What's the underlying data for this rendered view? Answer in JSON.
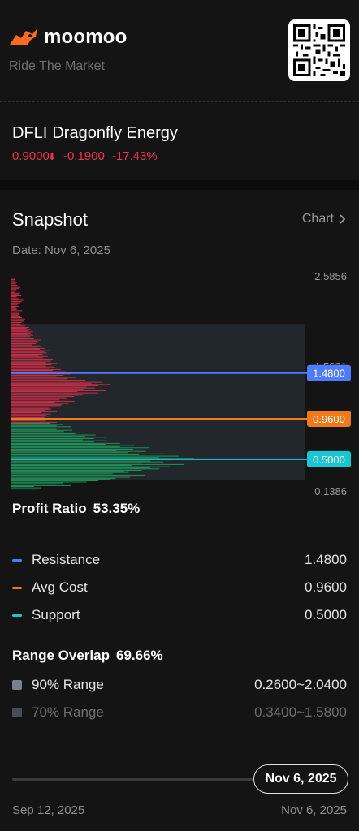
{
  "brand": {
    "name": "moomoo",
    "tagline": "Ride The Market"
  },
  "stock": {
    "ticker": "DFLI",
    "name": "Dragonfly Energy",
    "price": "0.9000",
    "change": "-0.1900",
    "change_pct": "-17.43%"
  },
  "snapshot": {
    "title": "Snapshot",
    "chart_link": "Chart",
    "date_label": "Date: Nov 6, 2025"
  },
  "chart_data": {
    "type": "bar",
    "orientation": "horizontal",
    "description_axis": "price",
    "y_axis_labels": [
      "2.5856",
      "1.5621",
      "0.1386"
    ],
    "ylim": [
      0.1386,
      2.5856
    ],
    "lines": [
      {
        "name": "Resistance",
        "value": 1.48,
        "label": "1.4800",
        "color": "#4f7cff"
      },
      {
        "name": "Avg Cost",
        "value": 0.96,
        "label": "0.9600",
        "color": "#f07a1a"
      },
      {
        "name": "Support",
        "value": 0.5,
        "label": "0.5000",
        "color": "#19c7d3"
      }
    ],
    "range_band": [
      0.26,
      2.04
    ],
    "profit_color": "#d9304a",
    "loss_color": "#1fa060",
    "distribution": [
      {
        "price": 2.55,
        "value": 4
      },
      {
        "price": 2.5,
        "value": 6
      },
      {
        "price": 2.46,
        "value": 9
      },
      {
        "price": 2.42,
        "value": 5
      },
      {
        "price": 2.38,
        "value": 10
      },
      {
        "price": 2.34,
        "value": 7
      },
      {
        "price": 2.3,
        "value": 12
      },
      {
        "price": 2.26,
        "value": 8
      },
      {
        "price": 2.22,
        "value": 6
      },
      {
        "price": 2.18,
        "value": 11
      },
      {
        "price": 2.14,
        "value": 9
      },
      {
        "price": 2.1,
        "value": 14
      },
      {
        "price": 2.06,
        "value": 12
      },
      {
        "price": 2.02,
        "value": 18
      },
      {
        "price": 1.98,
        "value": 20
      },
      {
        "price": 1.94,
        "value": 22
      },
      {
        "price": 1.9,
        "value": 25
      },
      {
        "price": 1.86,
        "value": 30
      },
      {
        "price": 1.82,
        "value": 28
      },
      {
        "price": 1.78,
        "value": 34
      },
      {
        "price": 1.74,
        "value": 38
      },
      {
        "price": 1.7,
        "value": 36
      },
      {
        "price": 1.66,
        "value": 42
      },
      {
        "price": 1.62,
        "value": 40
      },
      {
        "price": 1.58,
        "value": 46
      },
      {
        "price": 1.54,
        "value": 50
      },
      {
        "price": 1.5,
        "value": 55
      },
      {
        "price": 1.46,
        "value": 60
      },
      {
        "price": 1.42,
        "value": 75
      },
      {
        "price": 1.38,
        "value": 92
      },
      {
        "price": 1.34,
        "value": 100
      },
      {
        "price": 1.3,
        "value": 96
      },
      {
        "price": 1.26,
        "value": 88
      },
      {
        "price": 1.22,
        "value": 72
      },
      {
        "price": 1.18,
        "value": 64
      },
      {
        "price": 1.14,
        "value": 58
      },
      {
        "price": 1.1,
        "value": 50
      },
      {
        "price": 1.06,
        "value": 46
      },
      {
        "price": 1.02,
        "value": 40
      },
      {
        "price": 0.98,
        "value": 38
      },
      {
        "price": 0.94,
        "value": 46
      },
      {
        "price": 0.9,
        "value": 52
      },
      {
        "price": 0.86,
        "value": 60
      },
      {
        "price": 0.82,
        "value": 70
      },
      {
        "price": 0.78,
        "value": 85
      },
      {
        "price": 0.74,
        "value": 95
      },
      {
        "price": 0.7,
        "value": 110
      },
      {
        "price": 0.66,
        "value": 125
      },
      {
        "price": 0.62,
        "value": 140
      },
      {
        "price": 0.58,
        "value": 155
      },
      {
        "price": 0.54,
        "value": 170
      },
      {
        "price": 0.5,
        "value": 185
      },
      {
        "price": 0.46,
        "value": 175
      },
      {
        "price": 0.42,
        "value": 160
      },
      {
        "price": 0.38,
        "value": 150
      },
      {
        "price": 0.34,
        "value": 135
      },
      {
        "price": 0.3,
        "value": 120
      },
      {
        "price": 0.26,
        "value": 100
      },
      {
        "price": 0.22,
        "value": 60
      },
      {
        "price": 0.18,
        "value": 30
      }
    ]
  },
  "profit": {
    "label": "Profit Ratio",
    "value": "53.35%"
  },
  "levels": [
    {
      "label": "Resistance",
      "value": "1.4800",
      "color": "#4f7cff"
    },
    {
      "label": "Avg Cost",
      "value": "0.9600",
      "color": "#f07a1a"
    },
    {
      "label": "Support",
      "value": "0.5000",
      "color": "#19c7d3"
    }
  ],
  "overlap": {
    "label": "Range Overlap",
    "value": "69.66%",
    "ranges": [
      {
        "label": "90% Range",
        "value": "0.2600~2.0400",
        "color": "#7a8088"
      },
      {
        "label": "70% Range",
        "value": "0.3400~1.5800",
        "color": "#5a5e64"
      }
    ]
  },
  "timeline": {
    "current": "Nov 6, 2025",
    "start": "Sep 12, 2025",
    "end": "Nov 6, 2025"
  }
}
